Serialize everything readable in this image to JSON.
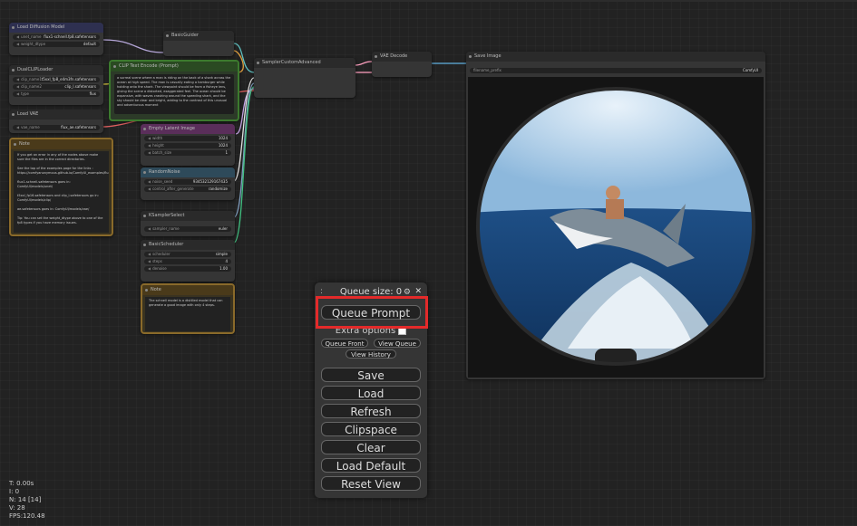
{
  "stats": {
    "t": "T: 0.00s",
    "i": "I: 0",
    "n": "N: 14 [14]",
    "v": "V: 28",
    "fps": "FPS:120.48"
  },
  "nodes": {
    "load_diffusion": {
      "title": "Load Diffusion Model",
      "widgets": [
        {
          "name": "unet_name",
          "value": "flux1-schnell.fp8.safetensors"
        },
        {
          "name": "weight_dtype",
          "value": "default"
        }
      ]
    },
    "dual_clip": {
      "title": "DualCLIPLoader",
      "widgets": [
        {
          "name": "clip_name1",
          "value": "t5xxl_fp8_e4m3fn.safetensors"
        },
        {
          "name": "clip_name2",
          "value": "clip_l.safetensors"
        },
        {
          "name": "type",
          "value": "flux"
        }
      ]
    },
    "load_vae": {
      "title": "Load VAE",
      "widgets": [
        {
          "name": "vae_name",
          "value": "flux_ae.safetensors"
        }
      ]
    },
    "note1": {
      "title": "Note",
      "text": "If you get an error in any of the nodes above make sure the files are in the correct directories.\n\nSee the top of the examples page for the links : https://comfyanonymous.github.io/ComfyUI_examples/flux/\n\nflux1-schnell.safetensors goes in: ComfyUI/models/unet/\n\nt5xxl_fp16.safetensors and clip_l.safetensors go in: ComfyUI/models/clip/\n\nae.safetensors goes in: ComfyUI/models/vae/\n\nTip: You can set the weight_dtype above to one of the fp8 types if you have memory issues."
    },
    "guider": {
      "title": "BasicGuider"
    },
    "clip_text": {
      "title": "CLIP Text Encode (Prompt)",
      "text": "a surreal scene where a man is riding on the back of a shark across the ocean at high speed. The man is casually eating a hamburger while holding onto the shark. The viewpoint should be from a fisheye lens, giving the scene a distorted, exaggerated feel. The ocean should be expansive, with waves crashing around the speeding shark, and the sky should be clear and bright, adding to the contrast of this unusual and adventurous moment"
    },
    "sampler_adv": {
      "title": "SamplerCustomAdvanced"
    },
    "vae_decode": {
      "title": "VAE Decode"
    },
    "save_image": {
      "title": "Save Image",
      "widgets": [
        {
          "name": "filename_prefix",
          "value": "ComfyUI"
        }
      ]
    },
    "empty_latent": {
      "title": "Empty Latent Image",
      "widgets": [
        {
          "name": "width",
          "value": "1024"
        },
        {
          "name": "height",
          "value": "1024"
        },
        {
          "name": "batch_size",
          "value": "1"
        }
      ]
    },
    "random_noise": {
      "title": "RandomNoise",
      "widgets": [
        {
          "name": "noise_seed",
          "value": "934532129167435"
        },
        {
          "name": "control_after_generate",
          "value": "randomize"
        }
      ]
    },
    "ksampler_select": {
      "title": "KSamplerSelect",
      "widgets": [
        {
          "name": "sampler_name",
          "value": "euler"
        }
      ]
    },
    "basic_scheduler": {
      "title": "BasicScheduler",
      "widgets": [
        {
          "name": "scheduler",
          "value": "simple"
        },
        {
          "name": "steps",
          "value": "4"
        },
        {
          "name": "denoise",
          "value": "1.00"
        }
      ]
    },
    "note2": {
      "title": "Note",
      "text": "The schnell model is a distilled model that can generate a good image with only 4 steps."
    }
  },
  "menu": {
    "queue_size": "Queue size: 0",
    "drag_glyph": ":",
    "gear_glyph": "⚙",
    "close_glyph": "✕",
    "queue_prompt": "Queue Prompt",
    "extra_options": "Extra options",
    "queue_front": "Queue Front",
    "view_queue": "View Queue",
    "view_history": "View History",
    "save": "Save",
    "load": "Load",
    "refresh": "Refresh",
    "clipspace": "Clipspace",
    "clear": "Clear",
    "load_default": "Load Default",
    "reset_view": "Reset View"
  },
  "colors": {
    "highlight": "#e32a2a",
    "note_border": "#8a6a2a",
    "clip_border": "#3c7a2e",
    "latent_title": "#5a2e5a",
    "noise_title": "#2e4a5a"
  }
}
